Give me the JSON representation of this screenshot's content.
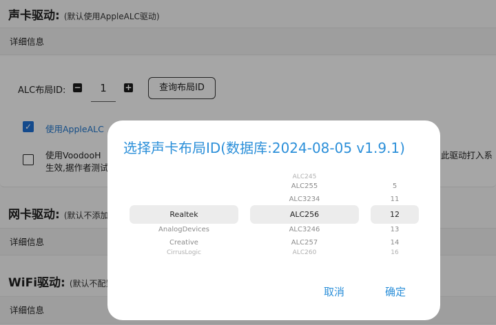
{
  "sections": {
    "audio": {
      "title": "声卡驱动:",
      "subtitle": "(默认使用AppleALC驱动)"
    },
    "network": {
      "title": "网卡驱动:",
      "subtitle": "(默认不添加"
    },
    "wifi": {
      "title": "WiFi驱动:",
      "subtitle": "(默认不配置"
    }
  },
  "details_label": "详细信息",
  "alc": {
    "label": "ALC布局ID:",
    "minus": "−",
    "plus": "+",
    "value": "1",
    "query_button": "查询布局ID"
  },
  "options": {
    "applealc": {
      "text": "使用AppleALC",
      "checked": true
    },
    "voodoohda": {
      "text_line1": "使用VoodooH",
      "text_line2": "生效,据作者测试",
      "right_text": "此驱动打入系",
      "checked": false
    }
  },
  "dialog": {
    "title": "选择声卡布局ID(数据库:2024-08-05 v1.9.1)",
    "vendors": {
      "above": "",
      "selected": "Realtek",
      "below": [
        "AnalogDevices",
        "Creative",
        "CirrusLogic"
      ]
    },
    "codecs": {
      "above": [
        "ALC245",
        "ALC255",
        "ALC3234"
      ],
      "selected": "ALC256",
      "below": [
        "ALC3246",
        "ALC257",
        "ALC260"
      ]
    },
    "ids": {
      "above": [
        "5",
        "11"
      ],
      "selected": "12",
      "below": [
        "13",
        "14",
        "16"
      ]
    },
    "cancel": "取消",
    "confirm": "确定"
  },
  "colors": {
    "accent": "#2b8fd9",
    "checkbox": "#1f6fd1"
  }
}
